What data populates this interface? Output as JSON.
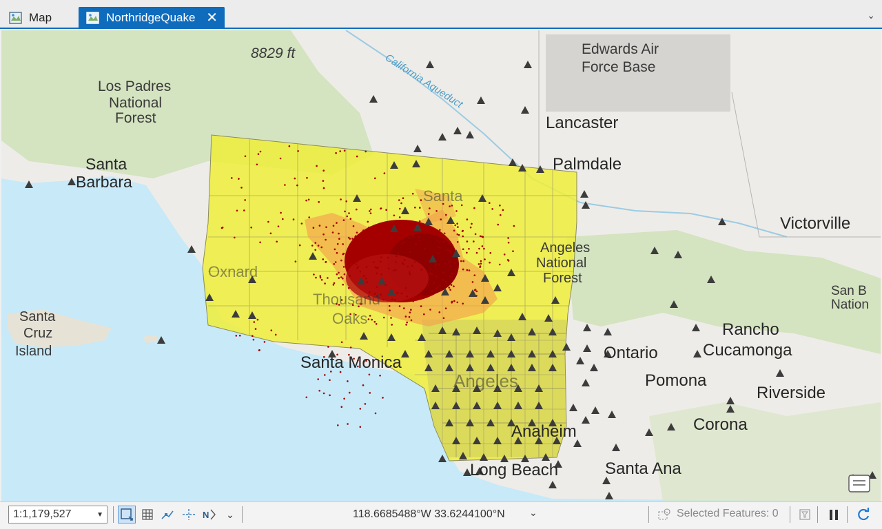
{
  "tabs": [
    {
      "label": "Map",
      "active": false,
      "icon": "map-icon"
    },
    {
      "label": "NorthridgeQuake",
      "active": true,
      "icon": "map-icon",
      "close_icon": "close-icon"
    }
  ],
  "tab_overflow_icon": "chevron-down-icon",
  "map": {
    "basemap": "World Topographic",
    "layers": [
      "earthquake-points",
      "census-polygons",
      "triangle-markers"
    ],
    "colors": {
      "water": "#c7e9f8",
      "land": "#eeece8",
      "forest": "#cfe2b9",
      "yellow_layer": "#eeee3a",
      "orange_zone": "#f2a24b",
      "quake_red": "#a40000",
      "marker": "#3c3c3c"
    },
    "labels": {
      "elevation": "8829 ft",
      "aqueduct": "California Aqueduct",
      "edwards": [
        "Edwards Air",
        "Force Base"
      ],
      "lancaster": "Lancaster",
      "palmdale": "Palmdale",
      "los_padres": [
        "Los Padres",
        "National",
        "Forest"
      ],
      "santa_barbara": [
        "Santa",
        "Barbara"
      ],
      "victorville": "Victorville",
      "angeles_forest": [
        "Angeles",
        "National",
        "Forest"
      ],
      "san_bern": [
        "San B",
        "Nation"
      ],
      "santa_cruz": [
        "Santa",
        "Cruz",
        "Island"
      ],
      "oxnard": "Oxnard",
      "thousand_oaks": [
        "Thousand",
        "Oaks"
      ],
      "santa_clarita": "Santa",
      "rancho": [
        "Rancho",
        "Cucamonga"
      ],
      "ontario": "Ontario",
      "pomona": "Pomona",
      "riverside": "Riverside",
      "corona": "Corona",
      "santa_monica": "Santa Monica",
      "los_angeles": "Angeles",
      "anaheim": "Anaheim",
      "long_beach": "Long Beach",
      "santa_ana": "Santa Ana"
    }
  },
  "status": {
    "scale": "1:1,179,527",
    "coordinates": "118.6685488°W 33.6244100°N",
    "selected_features": "Selected Features: 0",
    "icons": [
      "fixed-zoom-icon",
      "grid-icon",
      "snapping-icon",
      "guides-icon",
      "north-arrow-icon",
      "chevron-down-icon",
      "selection-icon",
      "filter-icon",
      "pause-icon",
      "refresh-icon"
    ]
  }
}
